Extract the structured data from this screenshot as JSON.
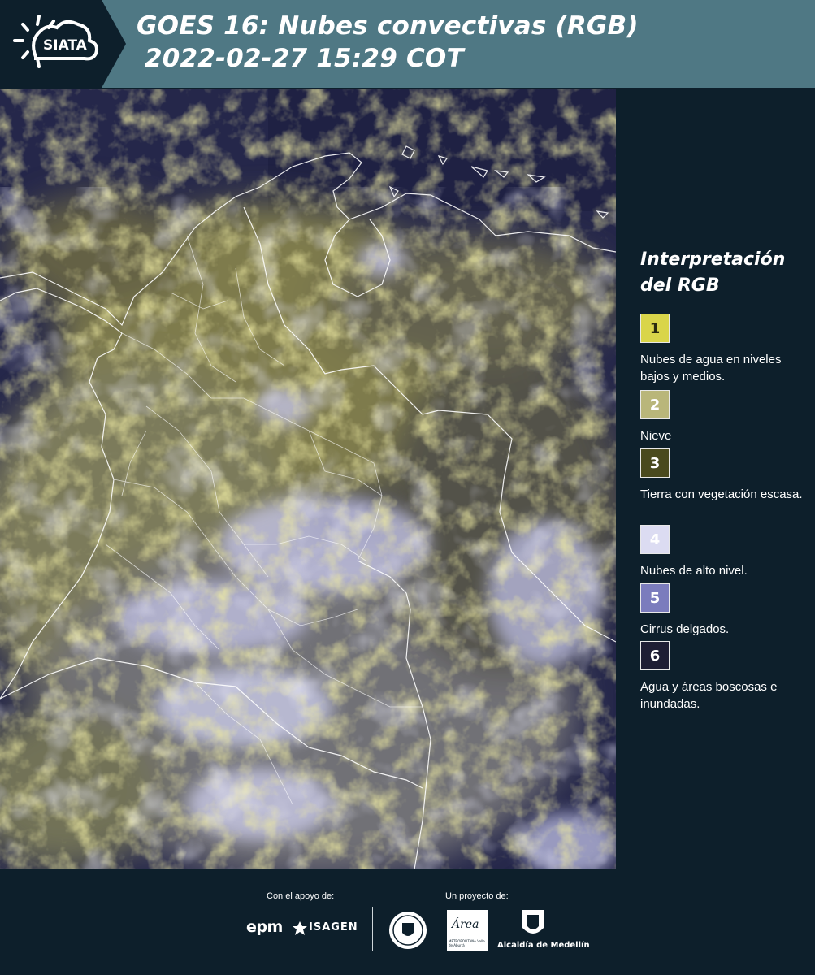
{
  "header": {
    "logo_text": "SIATA",
    "title_line1": "GOES 16: Nubes convectivas (RGB)",
    "title_line2": "2022-02-27 15:29 COT"
  },
  "legend": {
    "title": "Interpretación del RGB",
    "items": [
      {
        "number": "1",
        "label": "Nubes de agua en niveles bajos y medios.",
        "color": "#d9d54a",
        "text_color": "#2a2a10"
      },
      {
        "number": "2",
        "label": "Nieve",
        "color": "#b9b67a",
        "text_color": "#ffffff"
      },
      {
        "number": "3",
        "label": "Tierra con vegetación escasa.",
        "color": "#4a4a1e",
        "text_color": "#ffffff"
      },
      {
        "number": "4",
        "label": "Nubes de alto nivel.",
        "color": "#dcdcf2",
        "text_color": "#ffffff"
      },
      {
        "number": "5",
        "label": "Cirrus delgados.",
        "color": "#7b7cbd",
        "text_color": "#ffffff"
      },
      {
        "number": "6",
        "label": "Agua y áreas boscosas e inundadas.",
        "color": "#1e1e34",
        "text_color": "#ffffff"
      }
    ]
  },
  "footer": {
    "support_label": "Con el apoyo de:",
    "project_label": "Un proyecto de:",
    "epm_logo": "epm",
    "isagen_logo": "ISAGEN",
    "area_logo": "Área",
    "area_subtitle": "METROPOLITANA Valle de Aburrá",
    "alcaldia_label": "Alcaldía de Medellín"
  },
  "colors": {
    "header_bg": "#4f7884",
    "page_bg": "#0d1f2b",
    "low_cloud": "#cfc95a",
    "high_cloud": "#d8d8f0",
    "water": "#25274a"
  }
}
